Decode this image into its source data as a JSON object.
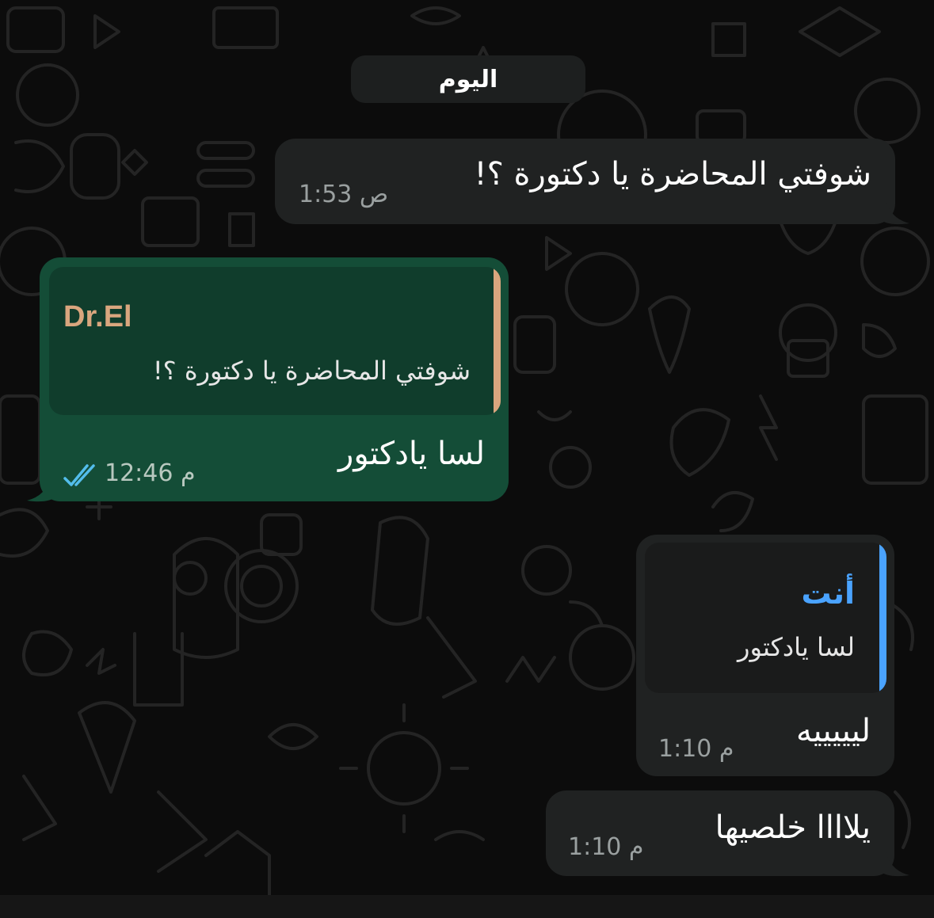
{
  "date_separator": "اليوم",
  "colors": {
    "incoming_bubble": "#202222",
    "outgoing_bubble": "#144d37",
    "reply_accent_sender": "#d9a67e",
    "reply_accent_self": "#4aa3ff",
    "read_receipt": "#53bdeb"
  },
  "messages": [
    {
      "direction": "incoming",
      "text": "شوفتي المحاضرة يا دكتورة ؟!",
      "time": "1:53 ص"
    },
    {
      "direction": "outgoing",
      "reply_to": {
        "sender": "Dr.El",
        "text": "شوفتي المحاضرة يا دكتورة ؟!"
      },
      "text": "لسا يادكتور",
      "time": "12:46 م",
      "status_icon": "double-check-read-icon"
    },
    {
      "direction": "incoming",
      "reply_to": {
        "sender": "أنت",
        "text": "لسا يادكتور"
      },
      "text": "ليييييه",
      "time": "1:10 م"
    },
    {
      "direction": "incoming",
      "text": "يلاااا خلصيها",
      "time": "1:10 م"
    }
  ]
}
